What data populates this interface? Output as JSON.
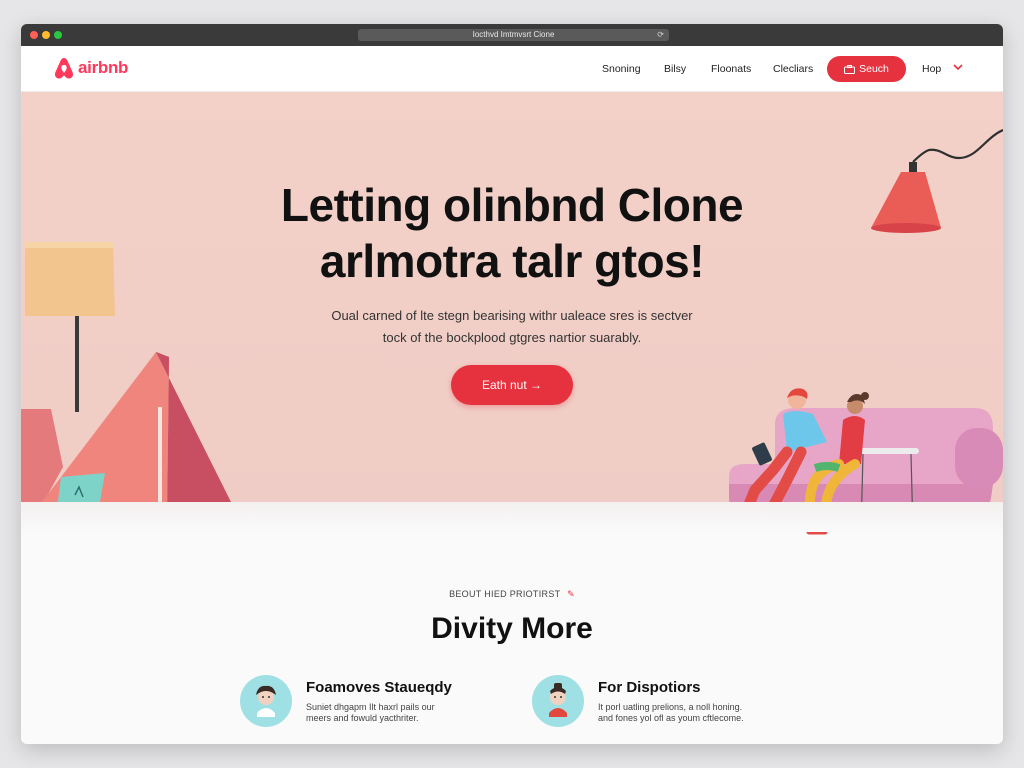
{
  "browser": {
    "address": "Iocthvd Imtmvsrt Cione"
  },
  "brand": {
    "name": "airbnb",
    "color": "#ff385c"
  },
  "nav": {
    "links": [
      "Snoning",
      "Bilsy",
      "Floonats",
      "Clecliars"
    ],
    "search_label": "Seuch",
    "search_icon": "suitcase-icon",
    "help_label": "Hop",
    "accent": "#e6323f"
  },
  "hero": {
    "title_line1": "Letting olinbnd Clone",
    "title_line2": "arlmotra talr gtos!",
    "subtitle_line1": "Oual carned of lte stegn bearising withr ualeace sres is sectver",
    "subtitle_line2": "tock of the bockplood gtgres nartior suarably.",
    "cta_label": "Eath nut →"
  },
  "section": {
    "eyebrow": "BEOUT HIED PRIOTIRST",
    "title": "Divity More"
  },
  "features": [
    {
      "title": "Foamoves Staueqdy",
      "desc_line1": "Suniet dhgapm Ilt haxrl pails our",
      "desc_line2": "meers and fowuld yacthriter.",
      "icon": "person-avatar-icon"
    },
    {
      "title": "For Dispotiors",
      "desc_line1": "It porl uatling prelions, a noll honing.",
      "desc_line2": "and fones yol ofl as youm cftlecome.",
      "icon": "person-avatar-icon"
    }
  ]
}
